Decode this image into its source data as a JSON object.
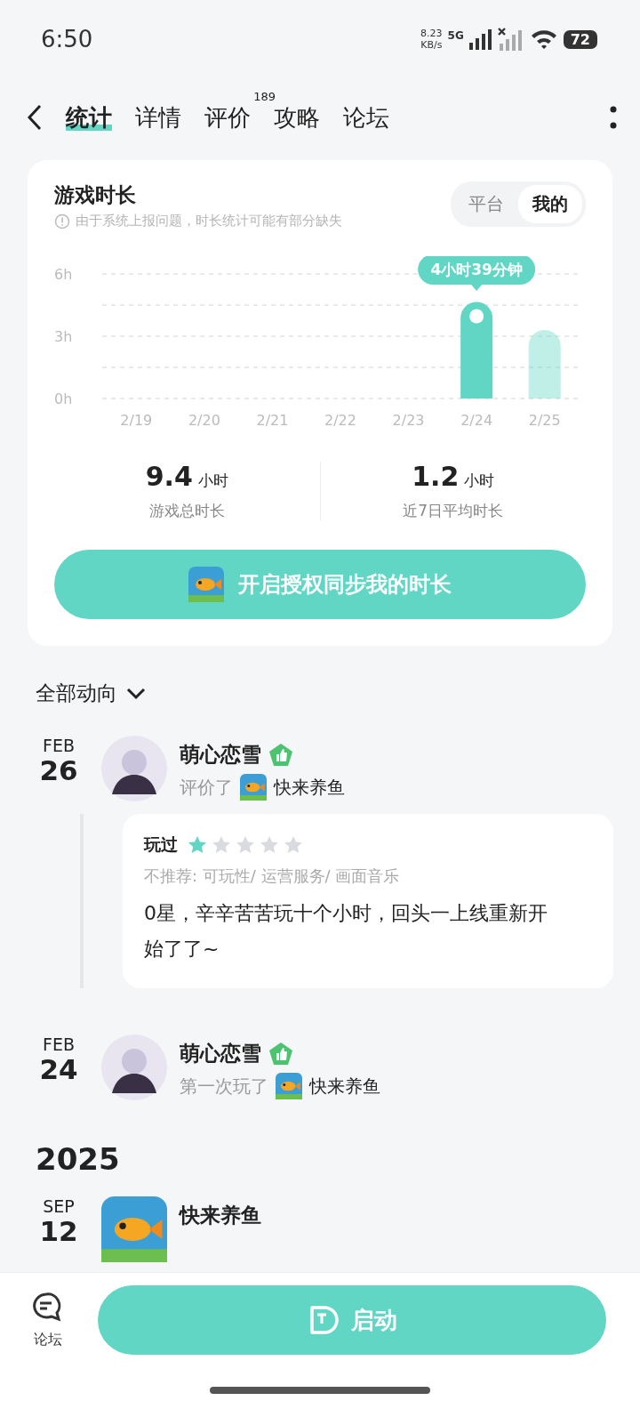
{
  "status_bar": {
    "time": "6:50",
    "net_speed": "8.23",
    "net_unit": "KB/s",
    "network": "5G",
    "battery": "72"
  },
  "tabs": [
    {
      "label": "统计",
      "selected": true
    },
    {
      "label": "详情",
      "selected": false
    },
    {
      "label": "评价",
      "selected": false,
      "count": "189"
    },
    {
      "label": "攻略",
      "selected": false
    },
    {
      "label": "论坛",
      "selected": false
    }
  ],
  "stats_card": {
    "title": "游戏时长",
    "notice": "由于系统上报问题，时长统计可能有部分缺失",
    "toggle": [
      {
        "label": "平台",
        "selected": false
      },
      {
        "label": "我的",
        "selected": true
      }
    ],
    "chart_data": {
      "type": "bar",
      "categories": [
        "2/19",
        "2/20",
        "2/21",
        "2/22",
        "2/23",
        "2/24",
        "2/25"
      ],
      "series": [
        {
          "color": "#62d6c4",
          "values": [
            0,
            0,
            0,
            0,
            0,
            4.65,
            3.3
          ]
        }
      ],
      "ylim": [
        0,
        6
      ],
      "yticks": [
        {
          "value": 0,
          "label": "0h"
        },
        {
          "value": 3,
          "label": "3h"
        },
        {
          "value": 6,
          "label": "6h"
        }
      ],
      "annotations": [
        "4小时39分钟"
      ]
    },
    "totals": [
      {
        "value": "9.4",
        "unit": "小时",
        "label": "游戏总时长"
      },
      {
        "value": "1.2",
        "unit": "小时",
        "label": "近7日平均时长"
      }
    ],
    "sync_button": "开启授权同步我的时长"
  },
  "feed": {
    "filter": "全部动向",
    "sections": [
      {
        "items": [
          {
            "kind": "review",
            "month": "FEB",
            "day": "26",
            "user": "萌心恋雪",
            "action": "评价了",
            "game": "快来养鱼",
            "review": {
              "status": "玩过",
              "stars": 1,
              "tags": "不推荐: 可玩性/ 运营服务/ 画面音乐",
              "text": "0星，辛辛苦苦玩十个小时，回头一上线重新开始了了~"
            }
          },
          {
            "kind": "play",
            "month": "FEB",
            "day": "24",
            "user": "萌心恋雪",
            "action": "第一次玩了",
            "game": "快来养鱼"
          }
        ]
      },
      {
        "year": "2025",
        "items": [
          {
            "kind": "official",
            "month": "SEP",
            "day": "12",
            "user": "快来养鱼"
          }
        ]
      }
    ]
  },
  "bottom_bar": {
    "forum_label": "论坛",
    "launch_button": "启动"
  }
}
